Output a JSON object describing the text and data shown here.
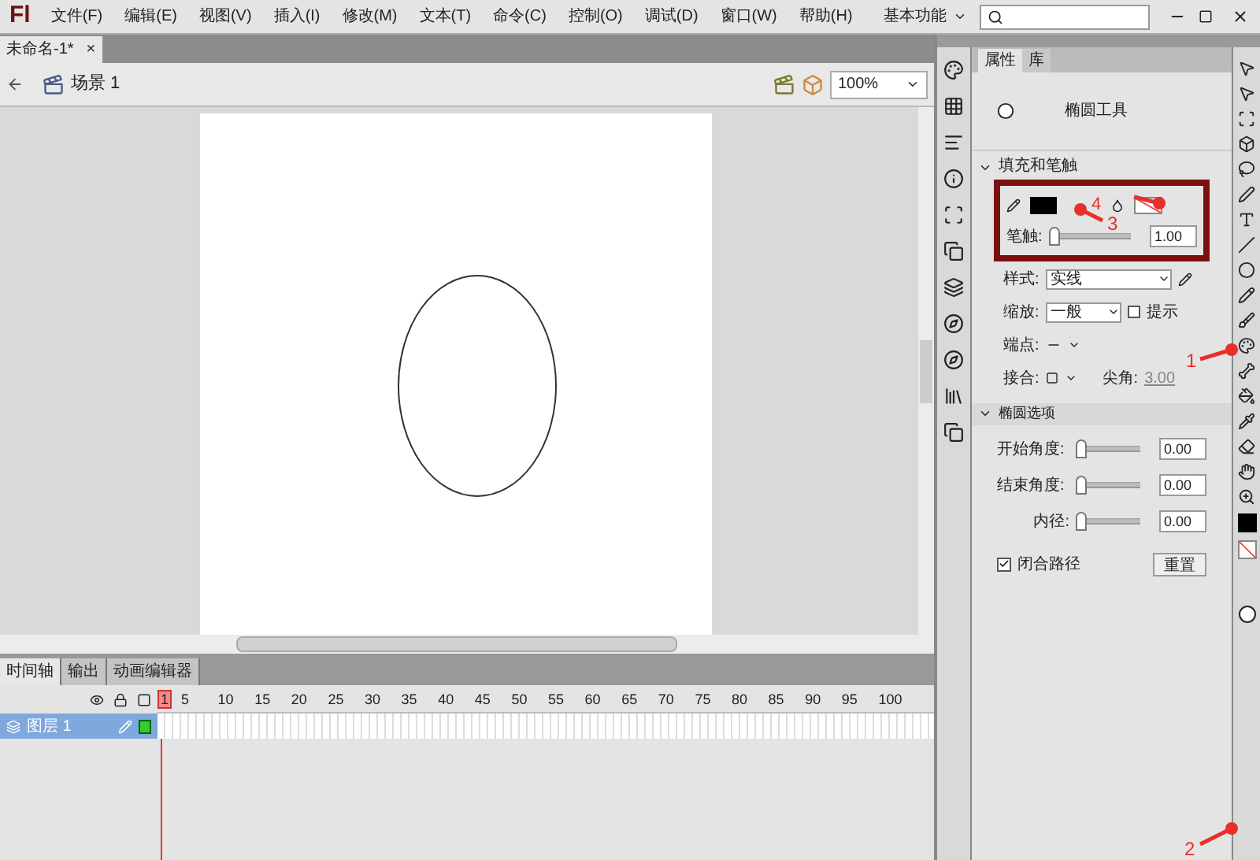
{
  "app_logo": "Fl",
  "menu": [
    "文件(F)",
    "编辑(E)",
    "视图(V)",
    "插入(I)",
    "修改(M)",
    "文本(T)",
    "命令(C)",
    "控制(O)",
    "调试(D)",
    "窗口(W)",
    "帮助(H)"
  ],
  "workspace": "基本功能",
  "document_tab": {
    "title": "未命名-1*",
    "close": "×"
  },
  "scene": "场景 1",
  "zoom": "100%",
  "timeline": {
    "tabs": [
      {
        "label": "时间轴",
        "selected": true
      },
      {
        "label": "输出",
        "selected": false
      },
      {
        "label": "动画编辑器",
        "selected": false
      }
    ],
    "frame_numbers": [
      "1",
      "5",
      "10",
      "15",
      "20",
      "25",
      "30",
      "35",
      "40",
      "45",
      "50",
      "55",
      "60",
      "65",
      "70",
      "75",
      "80",
      "85",
      "90",
      "95",
      "100"
    ],
    "layers": [
      {
        "name": "图层 1",
        "selected": true
      }
    ]
  },
  "properties": {
    "tabs": [
      {
        "label": "属性",
        "selected": true
      },
      {
        "label": "库",
        "selected": false
      }
    ],
    "tool_name": "椭圆工具",
    "fill_stroke": {
      "title": "填充和笔触",
      "stroke_label": "笔触:",
      "stroke_slider": {
        "level": 0
      },
      "stroke_value": "1.00",
      "style_label": "样式:",
      "style_value": "实线",
      "scale_label": "缩放:",
      "scale_value": "一般",
      "hint_label": "提示",
      "hint_checked": false,
      "cap_label": "端点:",
      "join_label": "接合:",
      "miter_label": "尖角:",
      "miter_value": "3.00"
    },
    "ellipse_options": {
      "title": "椭圆选项",
      "rows": [
        {
          "label": "开始角度:",
          "level": 0,
          "value": "0.00"
        },
        {
          "label": "结束角度:",
          "level": 0,
          "value": "0.00"
        },
        {
          "label": "内径:",
          "level": 0,
          "value": "0.00"
        }
      ],
      "close_path_label": "闭合路径",
      "close_path_checked": true,
      "reset": "重置"
    }
  },
  "annotations": [
    "1",
    "2",
    "3",
    "4"
  ]
}
